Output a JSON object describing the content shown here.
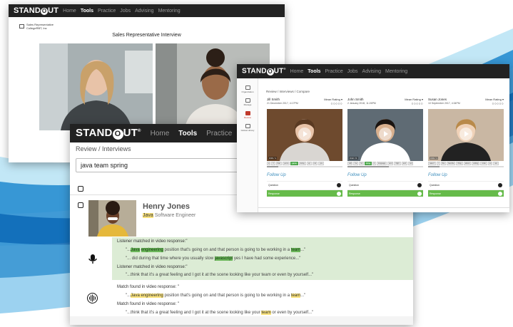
{
  "brand": {
    "logo_pre": "STAND",
    "logo_o": "O",
    "logo_post": "UT",
    "reg": "®"
  },
  "nav": [
    "Home",
    "Tools",
    "Practice",
    "Jobs",
    "Advising",
    "Mentoring"
  ],
  "nav_active": "Tools",
  "window1": {
    "company_line1": "Sales Representative",
    "company_line2": "CollegeRBT, Inc",
    "title": "Sales Representative Interview"
  },
  "window2": {
    "breadcrumb": "Review / Interviews",
    "search_value": "java team spring",
    "candidate_name": "Henry Jones",
    "candidate_role_hl": "Java",
    "candidate_role_rest": " Software Engineer",
    "listener_label_1": "Listener matched in video response:\"",
    "quote_1a_pre": "\"...",
    "quote_1a_kw1": "Java",
    "quote_1a_sp": " ",
    "quote_1a_kw2": "engineering",
    "quote_1a_mid": " position that's going on and that person is going to be working in a ",
    "quote_1a_kw3": "team",
    "quote_1a_post": "...\"",
    "quote_1b_pre": "\"... did during that time where you usually slow ",
    "quote_1b_kw": "javascript",
    "quote_1b_post": " yes I have had some experience...\"",
    "listener_label_2": "Listener matched in video response:\"",
    "quote_2": "\"...think that it's a great feeling and I got it at the scene looking like your team or even by yourself...\"",
    "match_label_1": "Match found in video response: \"",
    "quote_3_pre": "\"...",
    "quote_3_kw": "Java engineering",
    "quote_3_mid": " position that's going on and that person is going to be working in a ",
    "quote_3_kw2": "team",
    "quote_3_post": "...\"",
    "match_label_2": "Match found in video response: \"",
    "quote_4_pre": "\"...think that it's a great feeling and I got it at the scene looking like your ",
    "quote_4_kw": "team",
    "quote_4_post": " or even by yourself...\""
  },
  "window3": {
    "breadcrumb": "Review / Interviews / Compare",
    "sidebar": [
      {
        "label": "Organization",
        "icon": "building-icon",
        "active": false
      },
      {
        "label": "Manage",
        "icon": "edit-icon",
        "active": false
      },
      {
        "label": "Review",
        "icon": "thumbs-up-icon",
        "active": true
      },
      {
        "label": "Global Library",
        "icon": "book-icon",
        "active": false
      }
    ],
    "rating_label": "Mean Rating",
    "stars": "○○○○○",
    "followup_label": "Follow Up",
    "question_label": "Question",
    "response_label": "Response",
    "candidates": [
      {
        "name": "Jill Smith",
        "date": "21 December 2017, 4:17PM",
        "time": "0:00 / 1",
        "progress": 0.15,
        "words": [
          "a",
          "ll",
          "that",
          "you're",
          "game",
          "doing",
          "up",
          "not",
          "you"
        ],
        "active_word": 4
      },
      {
        "name": "John Smith",
        "date": "2 January 2018, 11:26PM",
        "time": "0:22 / 0:",
        "progress": 0.55,
        "words": [
          "will",
          "be",
          "for",
          "bring",
          "it",
          "language",
          "and",
          "flight",
          "and",
          "not"
        ],
        "active_word": 3
      },
      {
        "name": "Susan Jones",
        "date": "10 September 2017, 4:34PM",
        "time": "0:00 / 1",
        "progress": 0.15,
        "words": [
          "wasn't",
          "I",
          "the",
          "favorite",
          "thing",
          "about",
          "writing",
          "code",
          "so",
          "are"
        ],
        "active_word": -1
      }
    ]
  },
  "colors": {
    "nav_bg": "#222222",
    "highlight_green": "#6cb75b",
    "highlight_yellow": "#f9e27c",
    "match_bg": "#dcecd5",
    "action_green": "#66bb4a"
  }
}
